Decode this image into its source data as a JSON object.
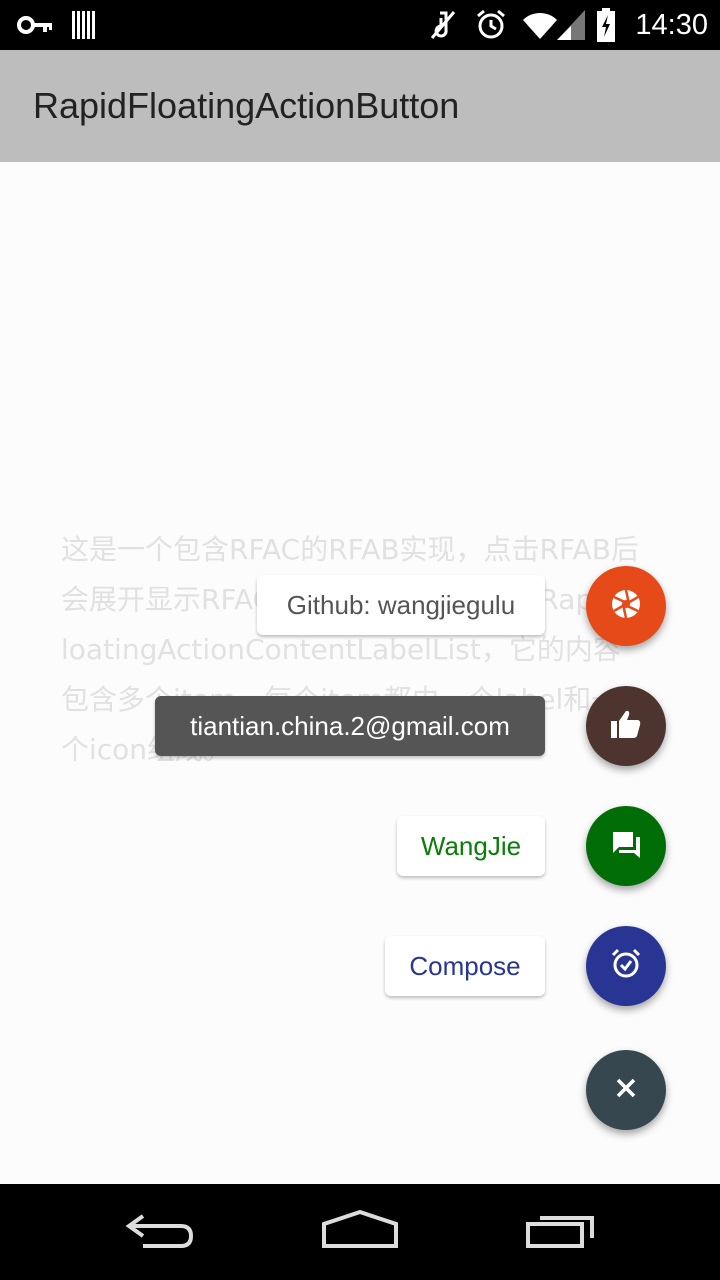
{
  "status_bar": {
    "time": "14:30",
    "icons": [
      "key-icon",
      "barcode-icon",
      "mute-icon",
      "alarm-icon",
      "wifi-icon",
      "signal-icon",
      "battery-icon"
    ]
  },
  "app_bar": {
    "title": "RapidFloatingActionButton"
  },
  "content": {
    "description": "这是一个包含RFAC的RFAB实现，点击RFAB后会展开显示RFAC，本案例RFAC实现为RapidFloatingActionContentLabelList，它的内容包含多个item，每个item都由一个label和一个icon组成。"
  },
  "fab_menu": {
    "items": [
      {
        "label": "Github: wangjiegulu",
        "icon": "aperture-icon",
        "fab_color": "#e64a19",
        "label_color": "#555555",
        "label_bg": "#ffffff"
      },
      {
        "label": "tiantian.china.2@gmail.com",
        "icon": "thumb-up-icon",
        "fab_color": "#4e342e",
        "label_color": "#ffffff",
        "label_bg": "#555555"
      },
      {
        "label": "WangJie",
        "icon": "forum-icon",
        "fab_color": "#006d07",
        "label_color": "#0a7d0a",
        "label_bg": "#ffffff"
      },
      {
        "label": "Compose",
        "icon": "alarm-on-icon",
        "fab_color": "#283593",
        "label_color": "#283593",
        "label_bg": "#ffffff"
      }
    ],
    "main_button": {
      "icon": "close-icon",
      "color": "#37474f"
    }
  },
  "nav_bar": {
    "buttons": [
      "back-icon",
      "home-icon",
      "recents-icon"
    ]
  }
}
